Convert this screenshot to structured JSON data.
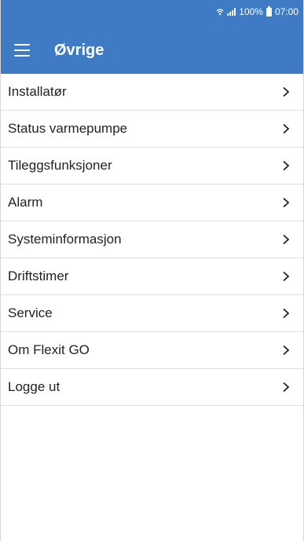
{
  "statusbar": {
    "battery": "100%",
    "time": "07:00",
    "icons": [
      "wifi-icon",
      "signal-icon",
      "battery-icon"
    ]
  },
  "toolbar": {
    "title": "Øvrige",
    "menu_icon": "hamburger-menu-icon"
  },
  "menu": {
    "items": [
      {
        "label": "Installatør"
      },
      {
        "label": "Status varmepumpe"
      },
      {
        "label": "Tileggsfunksjoner"
      },
      {
        "label": "Alarm"
      },
      {
        "label": "Systeminformasjon"
      },
      {
        "label": "Driftstimer"
      },
      {
        "label": "Service"
      },
      {
        "label": "Om Flexit GO"
      },
      {
        "label": "Logge ut"
      }
    ],
    "chevron_icon": "chevron-right-icon"
  },
  "colors": {
    "primary": "#3f7bc5",
    "background": "#ffffff",
    "divider": "#dddddd",
    "text": "#222222"
  }
}
